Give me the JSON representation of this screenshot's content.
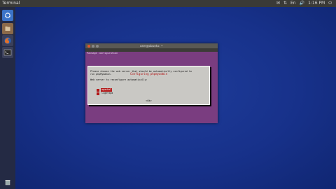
{
  "topbar": {
    "app_title": "Terminal",
    "tray_items": [
      "✉",
      "⇅",
      "En",
      "🔊",
      "1:16 PM",
      "⏻"
    ]
  },
  "launcher": {
    "items": [
      {
        "name": "dash-home-icon",
        "color": "#3b73c8"
      },
      {
        "name": "files-icon",
        "color": "#8b6a4a"
      },
      {
        "name": "firefox-icon",
        "color": "#e0702a"
      },
      {
        "name": "terminal-icon",
        "color": "#2a2a2a"
      }
    ],
    "trash_icon": "trash-icon"
  },
  "terminal": {
    "title": "user@ubuntu: ~",
    "package_line": "Package configuration",
    "dialog": {
      "title": "Configuring phpmyadmin",
      "line1": "Please choose the web server that should be automatically configured to",
      "line2": "run phpMyAdmin.",
      "prompt": "Web server to reconfigure automatically:",
      "options": [
        {
          "label": "apache2",
          "selected": true
        },
        {
          "label": "lighttpd",
          "selected": false
        }
      ],
      "ok": "<Ok>"
    }
  },
  "colors": {
    "desktop": "#17318a",
    "terminal_bg": "#7a3d80",
    "dialog_bg": "#c9c8c4",
    "accent_red": "#b21818"
  }
}
